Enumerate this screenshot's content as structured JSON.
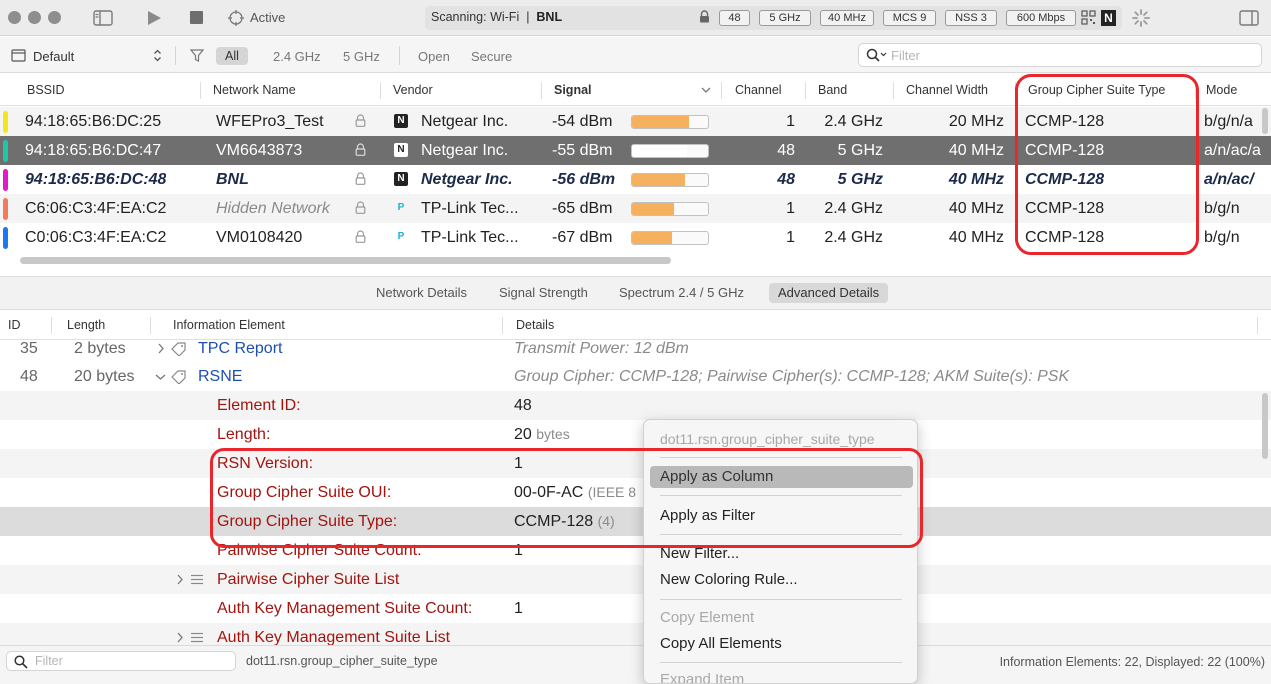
{
  "toolbar": {
    "active_label": "Active",
    "scan_prefix": "Scanning: Wi-Fi",
    "scan_separator": "|",
    "scan_network": "BNL",
    "pills": [
      "48",
      "5 GHz",
      "40 MHz",
      "MCS 9",
      "NSS 3",
      "600 Mbps"
    ],
    "vendor_badge": "N"
  },
  "filterbar": {
    "profile": "Default",
    "filters": [
      "All",
      "2.4 GHz",
      "5 GHz",
      "Open",
      "Secure"
    ],
    "search_placeholder": "Filter"
  },
  "networks": {
    "columns": [
      "BSSID",
      "Network Name",
      "Vendor",
      "Signal",
      "Channel",
      "Band",
      "Channel Width",
      "Group Cipher Suite Type",
      "Mode"
    ],
    "rows": [
      {
        "stripe": "#f4e61a",
        "bssid": "94:18:65:B6:DC:25",
        "name": "WFEPro3_Test",
        "vendor_badge": "N",
        "vendor": "Netgear Inc.",
        "signal": "-54 dBm",
        "signal_level": 0.75,
        "channel": "1",
        "band": "2.4 GHz",
        "width": "20 MHz",
        "cipher": "CCMP-128",
        "mode": "b/g/n/a"
      },
      {
        "stripe": "#1fc7a6",
        "bssid": "94:18:65:B6:DC:47",
        "name": "VM6643873",
        "vendor_badge": "N",
        "vendor": "Netgear Inc.",
        "signal": "-55 dBm",
        "signal_level": 0.73,
        "channel": "48",
        "band": "5 GHz",
        "width": "40 MHz",
        "cipher": "CCMP-128",
        "mode": "a/n/ac/a"
      },
      {
        "stripe": "#e619c9",
        "bssid": "94:18:65:B6:DC:48",
        "name": "BNL",
        "vendor_badge": "N",
        "vendor": "Netgear Inc.",
        "signal": "-56 dBm",
        "signal_level": 0.7,
        "channel": "48",
        "band": "5 GHz",
        "width": "40 MHz",
        "cipher": "CCMP-128",
        "mode": "a/n/ac/"
      },
      {
        "stripe": "#f47a5c",
        "bssid": "C6:06:C3:4F:EA:C2",
        "name": "Hidden Network",
        "vendor_badge": "P",
        "vendor": "TP-Link Tec...",
        "signal": "-65 dBm",
        "signal_level": 0.55,
        "channel": "1",
        "band": "2.4 GHz",
        "width": "40 MHz",
        "cipher": "CCMP-128",
        "mode": "b/g/n"
      },
      {
        "stripe": "#1b7af2",
        "bssid": "C0:06:C3:4F:EA:C2",
        "name": "VM0108420",
        "vendor_badge": "P",
        "vendor": "TP-Link Tec...",
        "signal": "-67 dBm",
        "signal_level": 0.52,
        "channel": "1",
        "band": "2.4 GHz",
        "width": "40 MHz",
        "cipher": "CCMP-128",
        "mode": "b/g/n"
      }
    ]
  },
  "tabs": [
    "Network Details",
    "Signal Strength",
    "Spectrum 2.4 / 5 GHz",
    "Advanced Details"
  ],
  "ie_table": {
    "columns": [
      "ID",
      "Length",
      "Information Element",
      "Details"
    ],
    "rows": [
      {
        "id": "35",
        "length": "2 bytes",
        "element": "TPC Report",
        "details": "Transmit Power: 12 dBm"
      },
      {
        "id": "48",
        "length": "20 bytes",
        "element": "RSNE",
        "details": "Group Cipher: CCMP-128; Pairwise Cipher(s): CCMP-128; AKM Suite(s): PSK"
      },
      {
        "element": "Element ID:",
        "details": "48"
      },
      {
        "element": "Length:",
        "details": "20",
        "details_suffix": "bytes"
      },
      {
        "element": "RSN Version:",
        "details": "1"
      },
      {
        "element": "Group Cipher Suite OUI:",
        "details": "00-0F-AC",
        "details_suffix": "(IEEE 8"
      },
      {
        "element": "Group Cipher Suite Type:",
        "details": "CCMP-128",
        "details_suffix": "(4)"
      },
      {
        "element": "Pairwise Cipher Suite Count:",
        "details": "1"
      },
      {
        "element": "Pairwise Cipher Suite List",
        "details": ""
      },
      {
        "element": "Auth Key Management Suite Count:",
        "details": "1"
      },
      {
        "element": "Auth Key Management Suite List",
        "details": ""
      }
    ]
  },
  "context_menu": {
    "header": "dot11.rsn.group_cipher_suite_type",
    "items": [
      "Apply as Column",
      "Apply as Filter",
      "New Filter...",
      "New Coloring Rule...",
      "Copy Element",
      "Copy All Elements",
      "Expand Item"
    ]
  },
  "bottombar": {
    "search_placeholder": "Filter",
    "field_name": "dot11.rsn.group_cipher_suite_type",
    "status": "Information Elements: 22, Displayed: 22 (100%)"
  }
}
